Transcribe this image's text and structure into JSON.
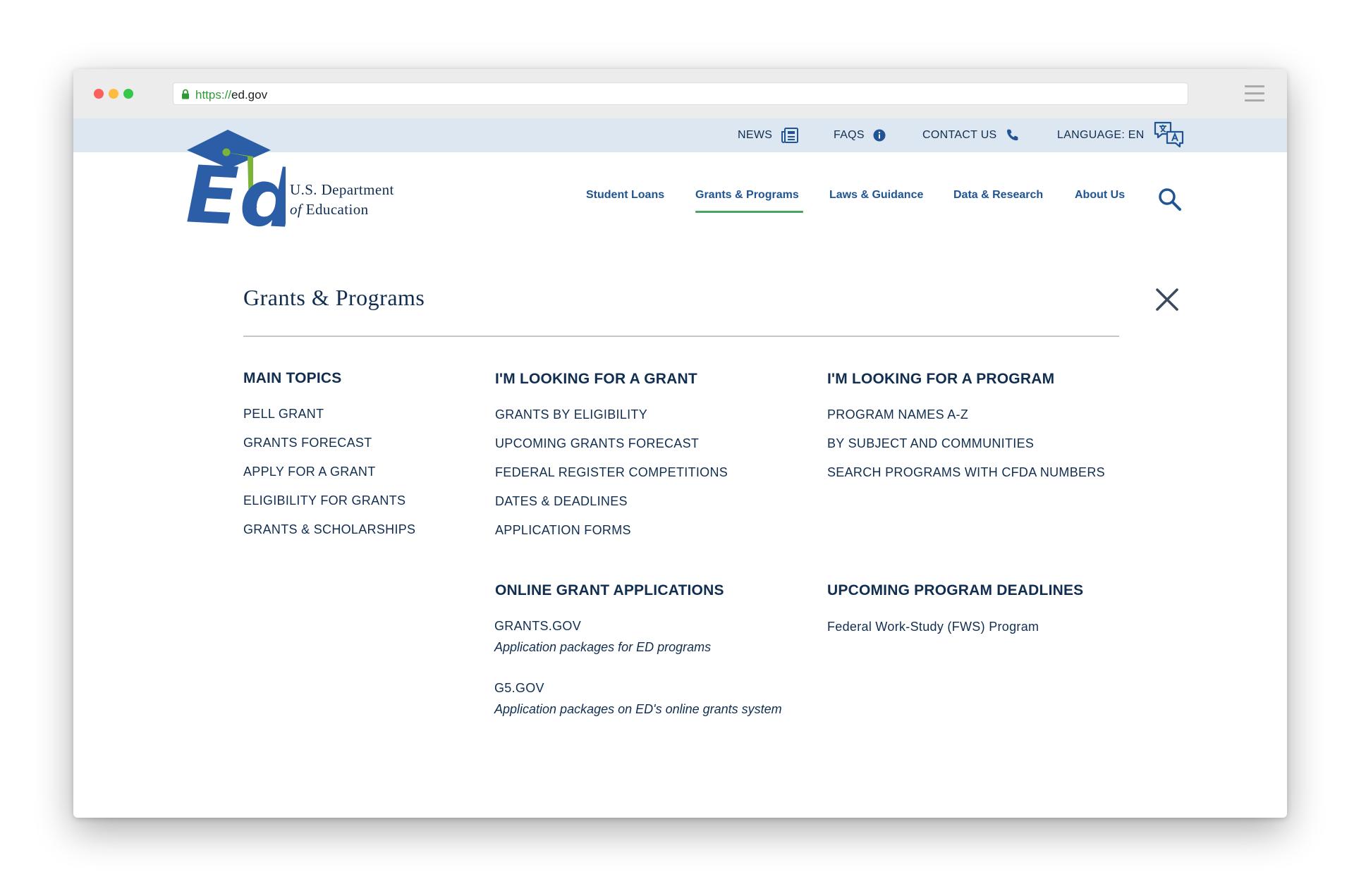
{
  "browser": {
    "url_scheme": "https://",
    "url_host": "ed.gov"
  },
  "utility_nav": [
    {
      "label": "NEWS",
      "icon": "newspaper-icon"
    },
    {
      "label": "FAQS",
      "icon": "info-icon"
    },
    {
      "label": "CONTACT US",
      "icon": "phone-icon"
    },
    {
      "label": "LANGUAGE: EN",
      "icon": "translate-icon"
    }
  ],
  "header": {
    "agency_line1": "U.S. Department",
    "agency_of": "of",
    "agency_line2": "Education",
    "logo_letters": "Ed"
  },
  "main_nav": [
    {
      "label": "Student Loans",
      "active": false
    },
    {
      "label": "Grants & Programs",
      "active": true
    },
    {
      "label": "Laws & Guidance",
      "active": false
    },
    {
      "label": "Data & Research",
      "active": false
    },
    {
      "label": "About Us",
      "active": false
    }
  ],
  "mega_menu": {
    "title": "Grants & Programs",
    "main_topics": {
      "heading": "MAIN TOPICS",
      "links": [
        "PELL GRANT",
        "GRANTS FORECAST",
        "APPLY FOR A GRANT",
        "ELIGIBILITY FOR GRANTS",
        "GRANTS & SCHOLARSHIPS"
      ]
    },
    "looking_for_grant": {
      "heading": "I'M LOOKING FOR A GRANT",
      "links": [
        "GRANTS BY ELIGIBILITY",
        "UPCOMING GRANTS FORECAST",
        "FEDERAL REGISTER COMPETITIONS",
        "DATES & DEADLINES",
        "APPLICATION FORMS"
      ]
    },
    "looking_for_program": {
      "heading": "I'M LOOKING FOR A PROGRAM",
      "links": [
        "PROGRAM NAMES A-Z",
        "BY SUBJECT AND COMMUNITIES",
        "SEARCH PROGRAMS WITH CFDA NUMBERS"
      ]
    },
    "online_grant_applications": {
      "heading": "ONLINE GRANT APPLICATIONS",
      "items": [
        {
          "label": "GRANTS.GOV",
          "desc": "Application packages for ED programs"
        },
        {
          "label": "G5.GOV",
          "desc": "Application packages on ED's online grants system"
        }
      ]
    },
    "upcoming_program_deadlines": {
      "heading": "UPCOMING PROGRAM DEADLINES",
      "links": [
        "Federal Work-Study (FWS) Program"
      ]
    }
  },
  "colors": {
    "navy": "#112e51",
    "link_blue": "#205493",
    "logo_blue": "#2c5ea7",
    "logo_green": "#7ab539",
    "active_underline": "#4aa564",
    "utility_bar_bg": "#dde7f1"
  }
}
